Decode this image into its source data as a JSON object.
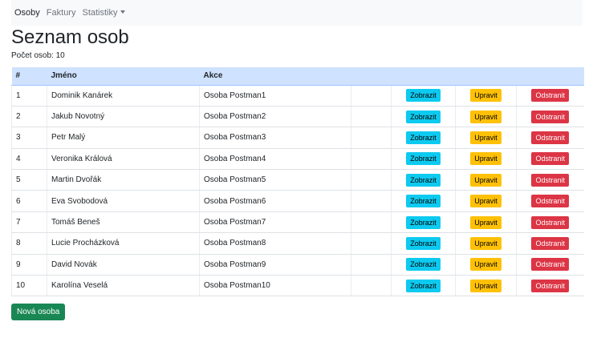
{
  "nav": {
    "items": [
      {
        "label": "Osoby"
      },
      {
        "label": "Faktury"
      },
      {
        "label": "Statistiky"
      }
    ]
  },
  "page": {
    "title": "Seznam osob",
    "count_label": "Počet osob: 10"
  },
  "table": {
    "headers": [
      "#",
      "Jméno",
      "Akce",
      "",
      "",
      "",
      ""
    ],
    "buttons": {
      "show": "Zobrazit",
      "edit": "Upravit",
      "delete": "Odstranit"
    },
    "rows": [
      {
        "id": "1",
        "name": "Dominik Kanárek",
        "note": "Osoba Postman1"
      },
      {
        "id": "2",
        "name": "Jakub Novotný",
        "note": "Osoba Postman2"
      },
      {
        "id": "3",
        "name": "Petr Malý",
        "note": "Osoba Postman3"
      },
      {
        "id": "4",
        "name": "Veronika Králová",
        "note": "Osoba Postman4"
      },
      {
        "id": "5",
        "name": "Martin Dvořák",
        "note": "Osoba Postman5"
      },
      {
        "id": "6",
        "name": "Eva Svobodová",
        "note": "Osoba Postman6"
      },
      {
        "id": "7",
        "name": "Tomáš Beneš",
        "note": "Osoba Postman7"
      },
      {
        "id": "8",
        "name": "Lucie Procházková",
        "note": "Osoba Postman8"
      },
      {
        "id": "9",
        "name": "David Novák",
        "note": "Osoba Postman9"
      },
      {
        "id": "10",
        "name": "Karolína Veselá",
        "note": "Osoba Postman10"
      }
    ]
  },
  "actions": {
    "new_label": "Nová osoba"
  },
  "colors": {
    "header_bg": "#cfe2ff",
    "info": "#0dcaf0",
    "warning": "#ffc107",
    "danger": "#dc3545",
    "success": "#198754"
  }
}
